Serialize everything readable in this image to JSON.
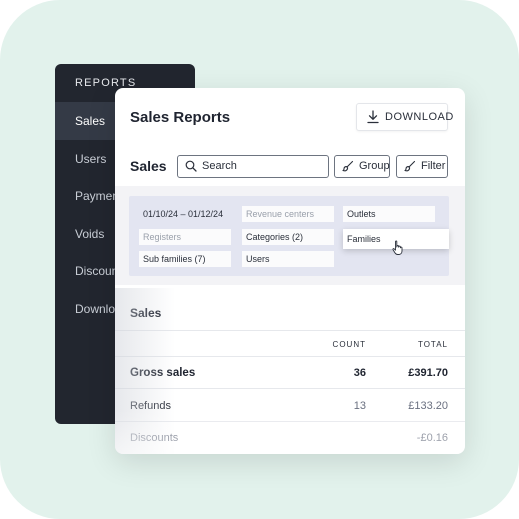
{
  "colors": {
    "background": "#e2f2ec",
    "sidebar": "#22262f",
    "sidebar_active": "#343a46",
    "filter_panel": "#e3e5f1"
  },
  "sidebar": {
    "heading": "REPORTS",
    "items": [
      {
        "label": "Sales",
        "active": true
      },
      {
        "label": "Users",
        "active": false
      },
      {
        "label": "Payments",
        "active": false
      },
      {
        "label": "Voids",
        "active": false
      },
      {
        "label": "Discounts",
        "active": false
      },
      {
        "label": "Downloads",
        "active": false
      }
    ]
  },
  "header": {
    "title": "Sales Reports",
    "download_label": "DOWNLOAD",
    "download_icon": "download-icon"
  },
  "toolbar": {
    "section_title": "Sales",
    "search_placeholder": "Search",
    "search_icon": "search-icon",
    "group_label": "Group",
    "group_icon": "brush-icon",
    "filter_label": "Filter",
    "filter_icon": "brush-icon"
  },
  "filters": {
    "date_range": "01/10/24 – 01/12/24",
    "revenue_centers": "Revenue centers",
    "outlets": "Outlets",
    "registers": "Registers",
    "categories": "Categories (2)",
    "families": "Families",
    "sub_families": "Sub families (7)",
    "users": "Users"
  },
  "table": {
    "title": "Sales",
    "columns": {
      "count": "COUNT",
      "total": "TOTAL"
    },
    "rows": [
      {
        "label": "Gross sales",
        "count": "36",
        "total": "£391.70"
      },
      {
        "label": "Refunds",
        "count": "13",
        "total": "£133.20"
      },
      {
        "label": "Discounts",
        "count": "",
        "total": "-£0.16"
      }
    ]
  }
}
